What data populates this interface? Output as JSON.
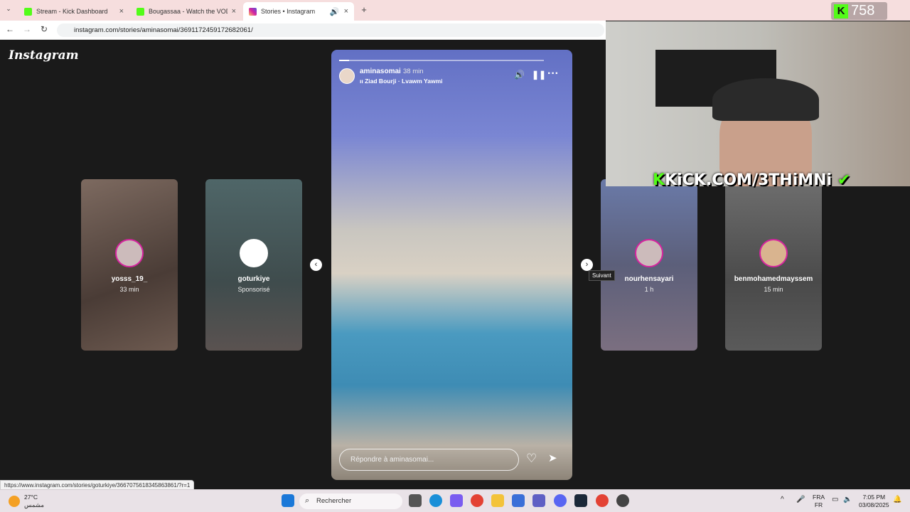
{
  "browser": {
    "tabs": [
      {
        "title": "Stream - Kick Dashboard",
        "favicon_color": "#53fc18"
      },
      {
        "title": "Bougassaa - Watch the VOD on",
        "favicon_color": "#53fc18"
      },
      {
        "title": "Stories • Instagram",
        "favicon_color": "#d6249f"
      }
    ],
    "url": "instagram.com/stories/aminasomai/3691172459172682061/",
    "new_tab": "+",
    "back": "←",
    "forward": "→",
    "reload": "↻"
  },
  "instagram": {
    "logo": "Instagram",
    "side_stories": [
      {
        "username": "yosss_19_",
        "sub": "33 min",
        "bg": "#5c4c46"
      },
      {
        "username": "goturkiye",
        "sub": "Sponsorisé",
        "bg": "#4d5b5e"
      },
      {
        "username": "nourhensayari",
        "sub": "1 h",
        "bg": "#6b6e87"
      },
      {
        "username": "benmohamedmayssem",
        "sub": "15 min",
        "bg": "#5e5e5e"
      }
    ],
    "story": {
      "username": "aminasomai",
      "time": "38 min",
      "music": "Ziad Bourji · Lvawm Yawmi",
      "reply_placeholder": "Répondre à aminasomai...",
      "progress": 0.05
    },
    "prev_arrow": "‹",
    "next_arrow": "›",
    "tooltip": "Suivant"
  },
  "overlay": {
    "viewers": "758",
    "kick_logo": "K",
    "kick_text": "KiCK.COM/3THiMNi"
  },
  "statusbar": {
    "link": "https://www.instagram.com/stories/goturkiye/3667075618345863861/?r=1"
  },
  "taskbar": {
    "temp": "27°C",
    "weather": "مشمس",
    "search": "Rechercher",
    "lang1": "FRA",
    "lang2": "FR",
    "time": "7:05 PM",
    "date": "03/08/2025"
  }
}
